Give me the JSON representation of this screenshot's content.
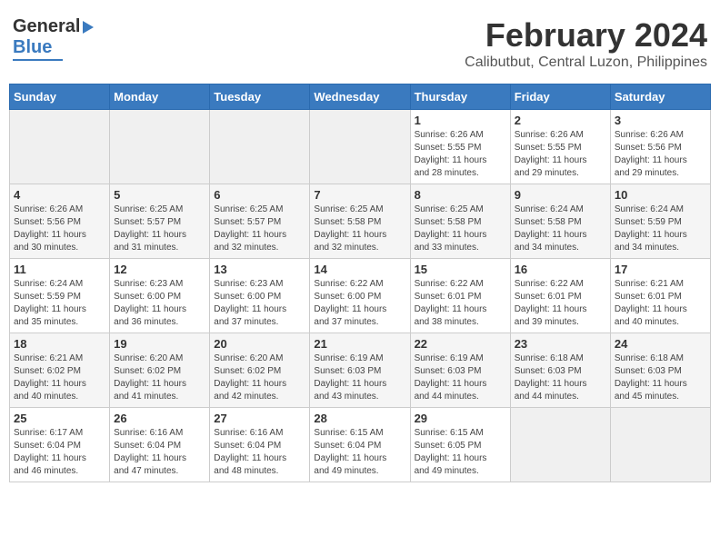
{
  "logo": {
    "general": "General",
    "blue": "Blue"
  },
  "title": {
    "month_year": "February 2024",
    "location": "Calibutbut, Central Luzon, Philippines"
  },
  "days_of_week": [
    "Sunday",
    "Monday",
    "Tuesday",
    "Wednesday",
    "Thursday",
    "Friday",
    "Saturday"
  ],
  "weeks": [
    [
      {
        "day": "",
        "info": ""
      },
      {
        "day": "",
        "info": ""
      },
      {
        "day": "",
        "info": ""
      },
      {
        "day": "",
        "info": ""
      },
      {
        "day": "1",
        "info": "Sunrise: 6:26 AM\nSunset: 5:55 PM\nDaylight: 11 hours\nand 28 minutes."
      },
      {
        "day": "2",
        "info": "Sunrise: 6:26 AM\nSunset: 5:55 PM\nDaylight: 11 hours\nand 29 minutes."
      },
      {
        "day": "3",
        "info": "Sunrise: 6:26 AM\nSunset: 5:56 PM\nDaylight: 11 hours\nand 29 minutes."
      }
    ],
    [
      {
        "day": "4",
        "info": "Sunrise: 6:26 AM\nSunset: 5:56 PM\nDaylight: 11 hours\nand 30 minutes."
      },
      {
        "day": "5",
        "info": "Sunrise: 6:25 AM\nSunset: 5:57 PM\nDaylight: 11 hours\nand 31 minutes."
      },
      {
        "day": "6",
        "info": "Sunrise: 6:25 AM\nSunset: 5:57 PM\nDaylight: 11 hours\nand 32 minutes."
      },
      {
        "day": "7",
        "info": "Sunrise: 6:25 AM\nSunset: 5:58 PM\nDaylight: 11 hours\nand 32 minutes."
      },
      {
        "day": "8",
        "info": "Sunrise: 6:25 AM\nSunset: 5:58 PM\nDaylight: 11 hours\nand 33 minutes."
      },
      {
        "day": "9",
        "info": "Sunrise: 6:24 AM\nSunset: 5:58 PM\nDaylight: 11 hours\nand 34 minutes."
      },
      {
        "day": "10",
        "info": "Sunrise: 6:24 AM\nSunset: 5:59 PM\nDaylight: 11 hours\nand 34 minutes."
      }
    ],
    [
      {
        "day": "11",
        "info": "Sunrise: 6:24 AM\nSunset: 5:59 PM\nDaylight: 11 hours\nand 35 minutes."
      },
      {
        "day": "12",
        "info": "Sunrise: 6:23 AM\nSunset: 6:00 PM\nDaylight: 11 hours\nand 36 minutes."
      },
      {
        "day": "13",
        "info": "Sunrise: 6:23 AM\nSunset: 6:00 PM\nDaylight: 11 hours\nand 37 minutes."
      },
      {
        "day": "14",
        "info": "Sunrise: 6:22 AM\nSunset: 6:00 PM\nDaylight: 11 hours\nand 37 minutes."
      },
      {
        "day": "15",
        "info": "Sunrise: 6:22 AM\nSunset: 6:01 PM\nDaylight: 11 hours\nand 38 minutes."
      },
      {
        "day": "16",
        "info": "Sunrise: 6:22 AM\nSunset: 6:01 PM\nDaylight: 11 hours\nand 39 minutes."
      },
      {
        "day": "17",
        "info": "Sunrise: 6:21 AM\nSunset: 6:01 PM\nDaylight: 11 hours\nand 40 minutes."
      }
    ],
    [
      {
        "day": "18",
        "info": "Sunrise: 6:21 AM\nSunset: 6:02 PM\nDaylight: 11 hours\nand 40 minutes."
      },
      {
        "day": "19",
        "info": "Sunrise: 6:20 AM\nSunset: 6:02 PM\nDaylight: 11 hours\nand 41 minutes."
      },
      {
        "day": "20",
        "info": "Sunrise: 6:20 AM\nSunset: 6:02 PM\nDaylight: 11 hours\nand 42 minutes."
      },
      {
        "day": "21",
        "info": "Sunrise: 6:19 AM\nSunset: 6:03 PM\nDaylight: 11 hours\nand 43 minutes."
      },
      {
        "day": "22",
        "info": "Sunrise: 6:19 AM\nSunset: 6:03 PM\nDaylight: 11 hours\nand 44 minutes."
      },
      {
        "day": "23",
        "info": "Sunrise: 6:18 AM\nSunset: 6:03 PM\nDaylight: 11 hours\nand 44 minutes."
      },
      {
        "day": "24",
        "info": "Sunrise: 6:18 AM\nSunset: 6:03 PM\nDaylight: 11 hours\nand 45 minutes."
      }
    ],
    [
      {
        "day": "25",
        "info": "Sunrise: 6:17 AM\nSunset: 6:04 PM\nDaylight: 11 hours\nand 46 minutes."
      },
      {
        "day": "26",
        "info": "Sunrise: 6:16 AM\nSunset: 6:04 PM\nDaylight: 11 hours\nand 47 minutes."
      },
      {
        "day": "27",
        "info": "Sunrise: 6:16 AM\nSunset: 6:04 PM\nDaylight: 11 hours\nand 48 minutes."
      },
      {
        "day": "28",
        "info": "Sunrise: 6:15 AM\nSunset: 6:04 PM\nDaylight: 11 hours\nand 49 minutes."
      },
      {
        "day": "29",
        "info": "Sunrise: 6:15 AM\nSunset: 6:05 PM\nDaylight: 11 hours\nand 49 minutes."
      },
      {
        "day": "",
        "info": ""
      },
      {
        "day": "",
        "info": ""
      }
    ]
  ]
}
